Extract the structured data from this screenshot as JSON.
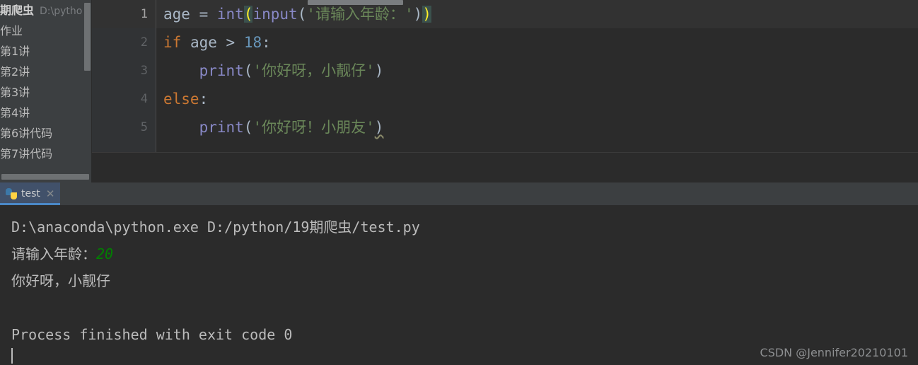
{
  "sidebar": {
    "items": [
      {
        "label": "期爬虫",
        "path": "D:\\pytho",
        "root": true
      },
      {
        "label": "作业",
        "path": "",
        "root": false
      },
      {
        "label": "第1讲",
        "path": "",
        "root": false
      },
      {
        "label": "第2讲",
        "path": "",
        "root": false
      },
      {
        "label": "第3讲",
        "path": "",
        "root": false
      },
      {
        "label": "第4讲",
        "path": "",
        "root": false
      },
      {
        "label": "第6讲代码",
        "path": "",
        "root": false
      },
      {
        "label": "第7讲代码",
        "path": "",
        "root": false
      }
    ]
  },
  "editor": {
    "gutter": [
      "1",
      "2",
      "3",
      "4",
      "5"
    ],
    "lines": [
      {
        "number": "1",
        "current": true,
        "tokens": [
          {
            "text": "age ",
            "cls": "t-plain"
          },
          {
            "text": "= ",
            "cls": "t-plain"
          },
          {
            "text": "int",
            "cls": "t-fn"
          },
          {
            "text": "(",
            "cls": "t-match"
          },
          {
            "text": "input",
            "cls": "t-fn"
          },
          {
            "text": "(",
            "cls": "t-paren"
          },
          {
            "text": "'请输入年龄：'",
            "cls": "t-str"
          },
          {
            "text": ")",
            "cls": "t-paren"
          },
          {
            "text": ")",
            "cls": "t-match"
          }
        ]
      },
      {
        "number": "2",
        "current": false,
        "tokens": [
          {
            "text": "if",
            "cls": "t-kw"
          },
          {
            "text": " age ",
            "cls": "t-plain"
          },
          {
            "text": "> ",
            "cls": "t-plain"
          },
          {
            "text": "18",
            "cls": "t-num"
          },
          {
            "text": ":",
            "cls": "t-plain"
          }
        ]
      },
      {
        "number": "3",
        "current": false,
        "tokens": [
          {
            "text": "    ",
            "cls": "t-plain"
          },
          {
            "text": "print",
            "cls": "t-fn"
          },
          {
            "text": "(",
            "cls": "t-paren"
          },
          {
            "text": "'你好呀，小靓仔'",
            "cls": "t-str"
          },
          {
            "text": ")",
            "cls": "t-paren"
          }
        ]
      },
      {
        "number": "4",
        "current": false,
        "tokens": [
          {
            "text": "else",
            "cls": "t-kw"
          },
          {
            "text": ":",
            "cls": "t-plain"
          }
        ]
      },
      {
        "number": "5",
        "current": false,
        "tokens": [
          {
            "text": "    ",
            "cls": "t-plain"
          },
          {
            "text": "print",
            "cls": "t-fn"
          },
          {
            "text": "(",
            "cls": "t-paren"
          },
          {
            "text": "'你好呀！小朋友'",
            "cls": "t-str"
          },
          {
            "text": ")",
            "cls": "t-paren squiggle"
          }
        ]
      }
    ]
  },
  "run_panel": {
    "tab_label": "test",
    "tab_close": "✕",
    "console_lines": [
      {
        "text": "D:\\anaconda\\python.exe D:/python/19期爬虫/test.py",
        "input": ""
      },
      {
        "text": "请输入年龄：",
        "input": "20"
      },
      {
        "text": "你好呀，小靓仔",
        "input": ""
      },
      {
        "text": "",
        "input": ""
      },
      {
        "text": "Process finished with exit code 0",
        "input": ""
      }
    ]
  },
  "watermark": {
    "text": "CSDN @Jennifer20210101"
  },
  "colors": {
    "editor_bg": "#2b2b2b",
    "sidebar_bg": "#3c3f41",
    "gutter_bg": "#313335",
    "tab_active": "#41516a",
    "tab_underline": "#4a88c7",
    "keyword": "#cc7832",
    "function": "#8888c6",
    "string": "#6a8759",
    "number": "#6897bb",
    "plain": "#a9b7c6",
    "bracket_match": "#ffef28",
    "console_text": "#bbbbbb",
    "console_input": "#008000"
  }
}
